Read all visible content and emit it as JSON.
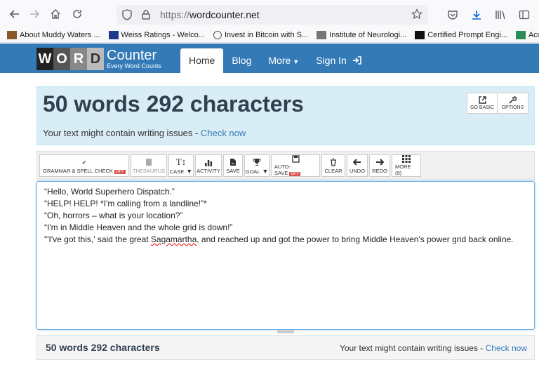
{
  "browser": {
    "url_protocol": "https://",
    "url_host": "wordcounter.net"
  },
  "bookmarks": [
    {
      "label": "About Muddy Waters ...",
      "icon": "muddy-waters-favicon",
      "color": "#8b5a2b"
    },
    {
      "label": "Weiss Ratings - Welco...",
      "icon": "weiss-ratings-favicon",
      "color": "#1e3a8a"
    },
    {
      "label": "Invest in Bitcoin with S...",
      "icon": "globe-icon",
      "color": "#555555"
    },
    {
      "label": "Institute of Neurologi...",
      "icon": "neurology-favicon",
      "color": "#777777"
    },
    {
      "label": "Certified Prompt Engi...",
      "icon": "notion-favicon",
      "color": "#111111"
    },
    {
      "label": "Access Certified",
      "icon": "access-favicon",
      "color": "#2e8b57"
    }
  ],
  "site": {
    "logo_letters": [
      "W",
      "O",
      "R",
      "D"
    ],
    "logo_name": "Counter",
    "logo_tagline": "Every Word Counts",
    "brand_color": "#337ab7",
    "nav": {
      "home": "Home",
      "blog": "Blog",
      "more": "More",
      "signin": "Sign In"
    }
  },
  "counts": {
    "title": "50 words 292 characters",
    "issues_text": "Your text might contain writing issues - ",
    "check_now": "Check now",
    "go_basic": "GO BASIC",
    "options": "OPTIONS"
  },
  "toolbar": {
    "grammar": "GRAMMAR & SPELL CHECK",
    "grammar_state": "OFF",
    "thesaurus": "THESAURUS",
    "case": "CASE",
    "activity": "ACTIVITY",
    "save": "SAVE",
    "goal": "GOAL",
    "autosave": "AUTO-SAVE",
    "autosave_state": "OFF",
    "clear": "CLEAR",
    "undo": "UNDO",
    "redo": "REDO",
    "more": "MORE (9)"
  },
  "editor": {
    "lines": [
      "“Hello, World Superhero Dispatch.”",
      "“HELP! HELP! *I'm calling from a landline!”*",
      "“Oh, horrors – what is your location?”",
      "“I'm in Middle Heaven and the whole grid is down!”",
      "\"'I've got this,' said the great ",
      "Sagamartha",
      ", and reached up and got the power to bring Middle Heaven's power grid back online."
    ]
  },
  "footer": {
    "title": "50 words 292 characters",
    "issues_text": "Your text might contain writing issues - ",
    "check_now": "Check now"
  }
}
